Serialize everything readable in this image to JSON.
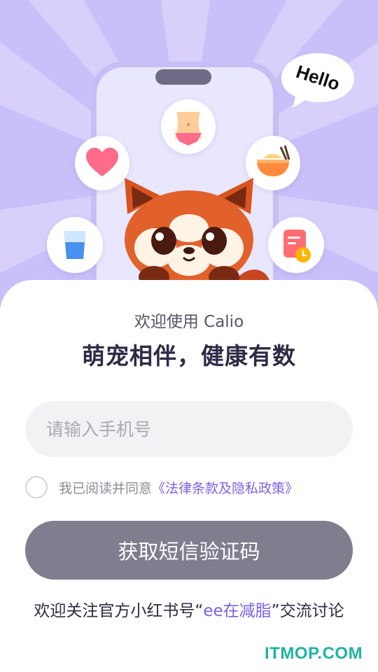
{
  "hero": {
    "hello_text": "Hello",
    "icons": [
      "heart-icon",
      "waist-icon",
      "food-bowl-icon",
      "water-glass-icon",
      "record-timer-icon",
      "red-panda-mascot"
    ],
    "colors": {
      "background": "#c9bff9",
      "phone_frame": "#c7bef5",
      "phone_screen": "#e8e7fd"
    }
  },
  "login": {
    "welcome": "欢迎使用 Calio",
    "slogan": "萌宠相伴，健康有数",
    "phone_placeholder": "请输入手机号",
    "agree_prefix": "我已阅读并同意",
    "policy_link": "《法律条款及隐私政策》",
    "sms_button": "获取短信验证码",
    "follow_prefix": "欢迎关注官方小红书号“",
    "follow_account": "ee在减脂",
    "follow_suffix": "”交流讨论",
    "accent_color": "#7763e8",
    "button_color": "#807d8f"
  },
  "watermark": "ITMOP.COM"
}
